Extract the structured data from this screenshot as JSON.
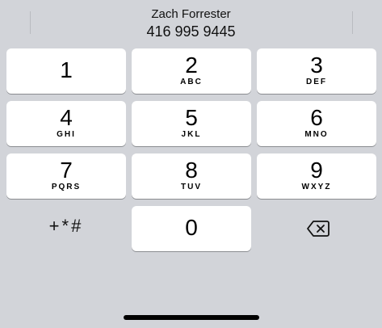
{
  "suggestion": {
    "name": "Zach Forrester",
    "number": "416 995 9445"
  },
  "keypad": {
    "keys": [
      {
        "digit": "1",
        "letters": ""
      },
      {
        "digit": "2",
        "letters": "ABC"
      },
      {
        "digit": "3",
        "letters": "DEF"
      },
      {
        "digit": "4",
        "letters": "GHI"
      },
      {
        "digit": "5",
        "letters": "JKL"
      },
      {
        "digit": "6",
        "letters": "MNO"
      },
      {
        "digit": "7",
        "letters": "PQRS"
      },
      {
        "digit": "8",
        "letters": "TUV"
      },
      {
        "digit": "9",
        "letters": "WXYZ"
      },
      {
        "digit": "0",
        "letters": ""
      }
    ],
    "symbols_label": "+*#",
    "delete_icon": "backspace-icon"
  },
  "colors": {
    "background": "#d2d4d9",
    "key": "#ffffff",
    "key_shadow": "#8a8c90",
    "text": "#000000"
  }
}
